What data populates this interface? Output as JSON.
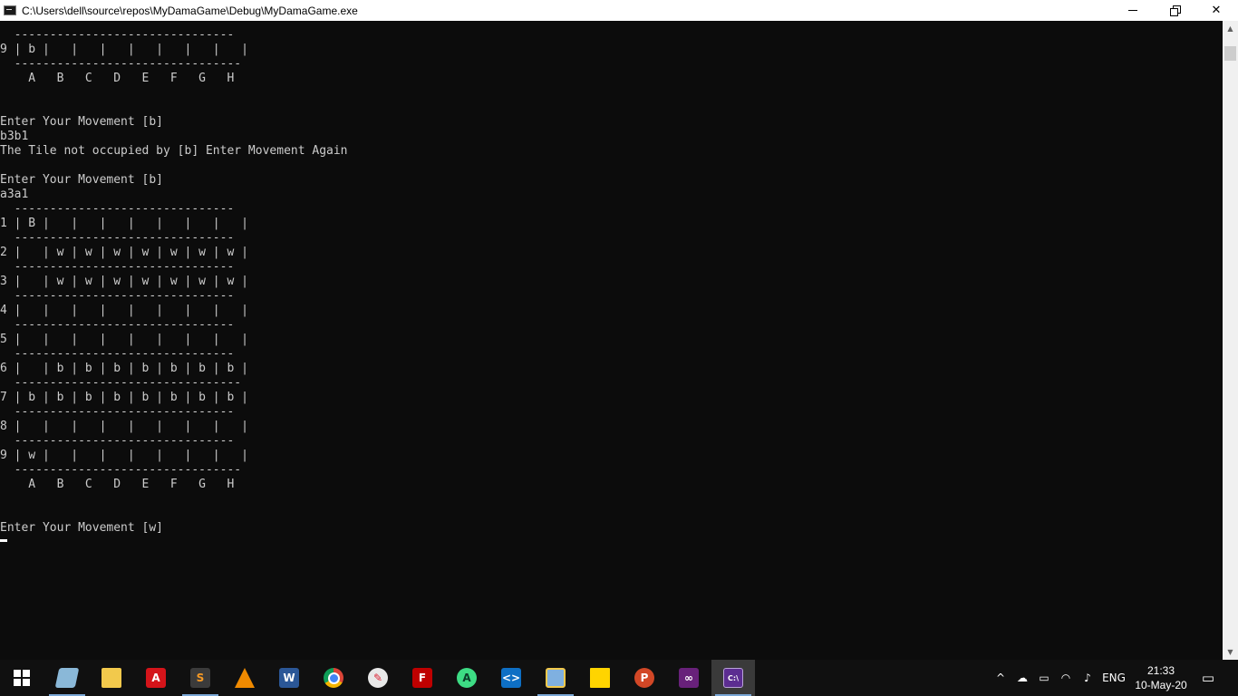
{
  "window": {
    "title": "C:\\Users\\dell\\source\\repos\\MyDamaGame\\Debug\\MyDamaGame.exe",
    "controls": {
      "minimize": "minimize",
      "maximize": "restore",
      "close": "✕"
    }
  },
  "console": {
    "lines": [
      "  -------------------------------",
      "9 | b |   |   |   |   |   |   |   |",
      "  --------------------------------",
      "    A   B   C   D   E   F   G   H",
      "",
      "",
      "Enter Your Movement [b]",
      "b3b1",
      "The Tile not occupied by [b] Enter Movement Again",
      "",
      "Enter Your Movement [b]",
      "a3a1",
      "  -------------------------------",
      "1 | B |   |   |   |   |   |   |   |",
      "  -------------------------------",
      "2 |   | w | w | w | w | w | w | w |",
      "  -------------------------------",
      "3 |   | w | w | w | w | w | w | w |",
      "  -------------------------------",
      "4 |   |   |   |   |   |   |   |   |",
      "  -------------------------------",
      "5 |   |   |   |   |   |   |   |   |",
      "  -------------------------------",
      "6 |   | b | b | b | b | b | b | b |",
      "  --------------------------------",
      "7 | b | b | b | b | b | b | b | b |",
      "  -------------------------------",
      "8 |   |   |   |   |   |   |   |   |",
      "  -------------------------------",
      "9 | w |   |   |   |   |   |   |   |",
      "  --------------------------------",
      "    A   B   C   D   E   F   G   H",
      "",
      "",
      "Enter Your Movement [w]"
    ]
  },
  "taskbar": {
    "apps": [
      {
        "name": "windows-start",
        "icon": "windows-logo-icon",
        "active": false,
        "running": false
      },
      {
        "name": "notes",
        "icon": "notepad-icon",
        "active": false,
        "running": true
      },
      {
        "name": "file-explorer",
        "icon": "folder-icon",
        "active": false,
        "running": false
      },
      {
        "name": "acrobat",
        "icon": "pdf-icon",
        "active": false,
        "running": false
      },
      {
        "name": "sublime",
        "icon": "sublime-icon",
        "active": false,
        "running": true
      },
      {
        "name": "vlc",
        "icon": "vlc-cone-icon",
        "active": false,
        "running": false
      },
      {
        "name": "word",
        "icon": "word-icon",
        "active": false,
        "running": false
      },
      {
        "name": "chrome",
        "icon": "chrome-icon",
        "active": false,
        "running": false
      },
      {
        "name": "paint",
        "icon": "paint-icon",
        "active": false,
        "running": false
      },
      {
        "name": "filezilla",
        "icon": "filezilla-icon",
        "active": false,
        "running": false
      },
      {
        "name": "android-studio",
        "icon": "android-studio-icon",
        "active": false,
        "running": false
      },
      {
        "name": "vscode",
        "icon": "vscode-icon",
        "active": false,
        "running": false
      },
      {
        "name": "virtualbox",
        "icon": "virtualbox-icon",
        "active": false,
        "running": true
      },
      {
        "name": "sticky-notes",
        "icon": "sticky-note-icon",
        "active": false,
        "running": false
      },
      {
        "name": "powerpoint",
        "icon": "powerpoint-icon",
        "active": false,
        "running": false
      },
      {
        "name": "visual-studio",
        "icon": "visual-studio-icon",
        "active": false,
        "running": false
      },
      {
        "name": "console",
        "icon": "console-icon",
        "active": true,
        "running": true
      }
    ],
    "tray": {
      "language": "ENG",
      "time": "21:33",
      "date": "10-May-20"
    }
  },
  "colors": {
    "console_bg": "#0c0c0c",
    "console_fg": "#cccccc",
    "taskbar_bg": "#101010",
    "active_app_bg": "#3a3a3a"
  }
}
